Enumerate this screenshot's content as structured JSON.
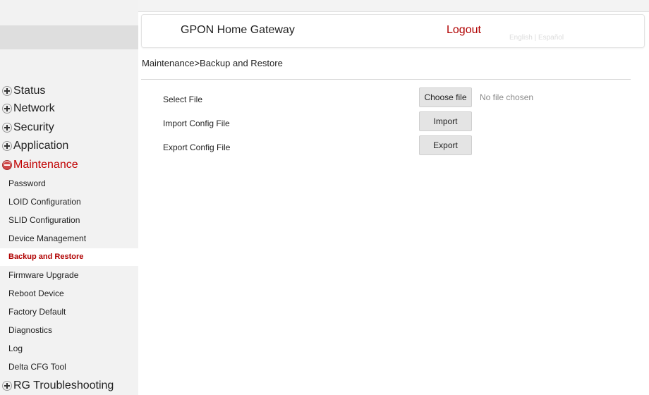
{
  "header": {
    "title": "GPON Home Gateway",
    "logout": "Logout",
    "language": "English | Español"
  },
  "breadcrumb": "Maintenance>Backup and Restore",
  "sidebar": {
    "groups_top": [
      {
        "label": "Status",
        "state": "collapsed"
      },
      {
        "label": "Network",
        "state": "collapsed"
      },
      {
        "label": "Security",
        "state": "collapsed"
      },
      {
        "label": "Application",
        "state": "collapsed"
      },
      {
        "label": "Maintenance",
        "state": "expanded"
      }
    ],
    "maintenance_items": [
      {
        "label": "Password"
      },
      {
        "label": "LOID Configuration"
      },
      {
        "label": "SLID Configuration"
      },
      {
        "label": "Device Management"
      },
      {
        "label": "Backup and Restore",
        "selected": true
      },
      {
        "label": "Firmware Upgrade"
      },
      {
        "label": "Reboot Device"
      },
      {
        "label": "Factory Default"
      },
      {
        "label": "Diagnostics"
      },
      {
        "label": "Log"
      },
      {
        "label": "Delta CFG Tool"
      }
    ],
    "groups_bottom": [
      {
        "label": "RG Troubleshooting",
        "state": "collapsed"
      }
    ]
  },
  "form": {
    "select_file_label": "Select File",
    "choose_file_button": "Choose file",
    "no_file_text": "No file chosen",
    "import_label": "Import Config File",
    "import_button": "Import",
    "export_label": "Export Config File",
    "export_button": "Export"
  },
  "colors": {
    "accent": "#b00000",
    "sidebar_bg": "#f2f2f2",
    "button_bg": "#e4e4e4"
  }
}
